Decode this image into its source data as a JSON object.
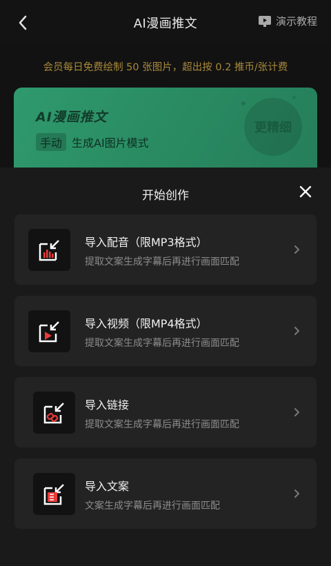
{
  "header": {
    "title": "AI漫画推文",
    "tutorial_label": "演示教程",
    "back_icon": "chevron-left-icon",
    "tutorial_icon": "play-screen-icon"
  },
  "member_note": "会员每日免费绘制 50 张图片，超出按 0.2 推币/张计费",
  "banner": {
    "title": "AI漫画推文",
    "tag": "手动",
    "subtitle": "生成AI图片模式",
    "badge": "更精细",
    "color": "#2f9a6d"
  },
  "sheet": {
    "title": "开始创作",
    "close_icon": "close-icon",
    "options": [
      {
        "label": "导入配音（限MP3格式）",
        "desc": "提取文案生成字幕后再进行画面匹配",
        "icon": "import-audio-icon"
      },
      {
        "label": "导入视频（限MP4格式）",
        "desc": "提取文案生成字幕后再进行画面匹配",
        "icon": "import-video-icon"
      },
      {
        "label": "导入链接",
        "desc": "提取文案生成字幕后再进行画面匹配",
        "icon": "import-link-icon"
      },
      {
        "label": "导入文案",
        "desc": "文案生成字幕后再进行画面匹配",
        "icon": "import-text-icon"
      }
    ]
  },
  "colors": {
    "accent_red": "#e83a3a",
    "note_gold": "#a98a3a"
  }
}
